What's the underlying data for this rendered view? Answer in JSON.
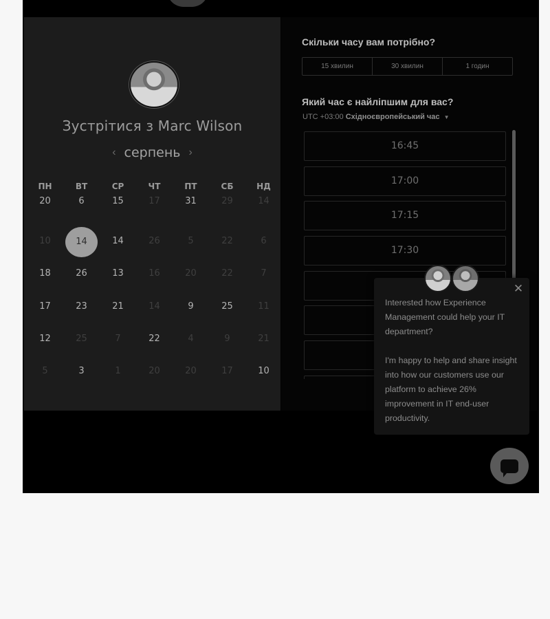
{
  "calendar": {
    "title": "Зустрітися з Marc Wilson",
    "month": "серпень",
    "prev_arrow": "‹",
    "next_arrow": "›",
    "weekdays": [
      "ПН",
      "ВТ",
      "СР",
      "ЧТ",
      "ПТ",
      "СБ",
      "НД"
    ],
    "rows": [
      [
        {
          "d": "20",
          "a": true
        },
        {
          "d": "6",
          "a": true
        },
        {
          "d": "15",
          "a": true
        },
        {
          "d": "17",
          "a": false
        },
        {
          "d": "31",
          "a": true
        },
        {
          "d": "29",
          "a": false
        },
        {
          "d": "14",
          "a": false
        }
      ],
      [
        {
          "d": "10",
          "a": false
        },
        {
          "d": "14",
          "a": true,
          "sel": true
        },
        {
          "d": "14",
          "a": true
        },
        {
          "d": "26",
          "a": false
        },
        {
          "d": "5",
          "a": false
        },
        {
          "d": "22",
          "a": false
        },
        {
          "d": "6",
          "a": false
        }
      ],
      [
        {
          "d": "18",
          "a": true
        },
        {
          "d": "26",
          "a": true
        },
        {
          "d": "13",
          "a": true
        },
        {
          "d": "16",
          "a": false
        },
        {
          "d": "20",
          "a": false
        },
        {
          "d": "22",
          "a": false
        },
        {
          "d": "7",
          "a": false
        }
      ],
      [
        {
          "d": "17",
          "a": true
        },
        {
          "d": "23",
          "a": true
        },
        {
          "d": "21",
          "a": true
        },
        {
          "d": "14",
          "a": false
        },
        {
          "d": "9",
          "a": true
        },
        {
          "d": "25",
          "a": true
        },
        {
          "d": "11",
          "a": false
        }
      ],
      [
        {
          "d": "12",
          "a": true
        },
        {
          "d": "25",
          "a": false
        },
        {
          "d": "7",
          "a": false
        },
        {
          "d": "22",
          "a": true
        },
        {
          "d": "4",
          "a": false
        },
        {
          "d": "9",
          "a": false
        },
        {
          "d": "21",
          "a": false
        }
      ],
      [
        {
          "d": "5",
          "a": false
        },
        {
          "d": "3",
          "a": true
        },
        {
          "d": "1",
          "a": false
        },
        {
          "d": "20",
          "a": false
        },
        {
          "d": "20",
          "a": false
        },
        {
          "d": "17",
          "a": false
        },
        {
          "d": "10",
          "a": true
        }
      ]
    ]
  },
  "schedule": {
    "duration_question": "Скільки часу вам потрібно?",
    "durations": [
      "15 хвилин",
      "30 хвилин",
      "1 годин"
    ],
    "time_question": "Який час є найліпшим для вас?",
    "tz_offset": "UTC +03:00",
    "tz_name": "Східноєвропейський час",
    "slots": [
      "16:45",
      "17:00",
      "17:15",
      "17:30",
      "",
      "",
      "",
      ""
    ]
  },
  "chat": {
    "message_1": "Interested how Experience Management could help your IT department?",
    "message_2": "I'm happy to help and share insight into how our customers use our platform to achieve 26% improvement in IT end-user productivity.",
    "close": "✕"
  },
  "icons": {
    "close": "close-icon",
    "chat": "chat-bubble-icon",
    "caret": "caret-down-icon"
  }
}
